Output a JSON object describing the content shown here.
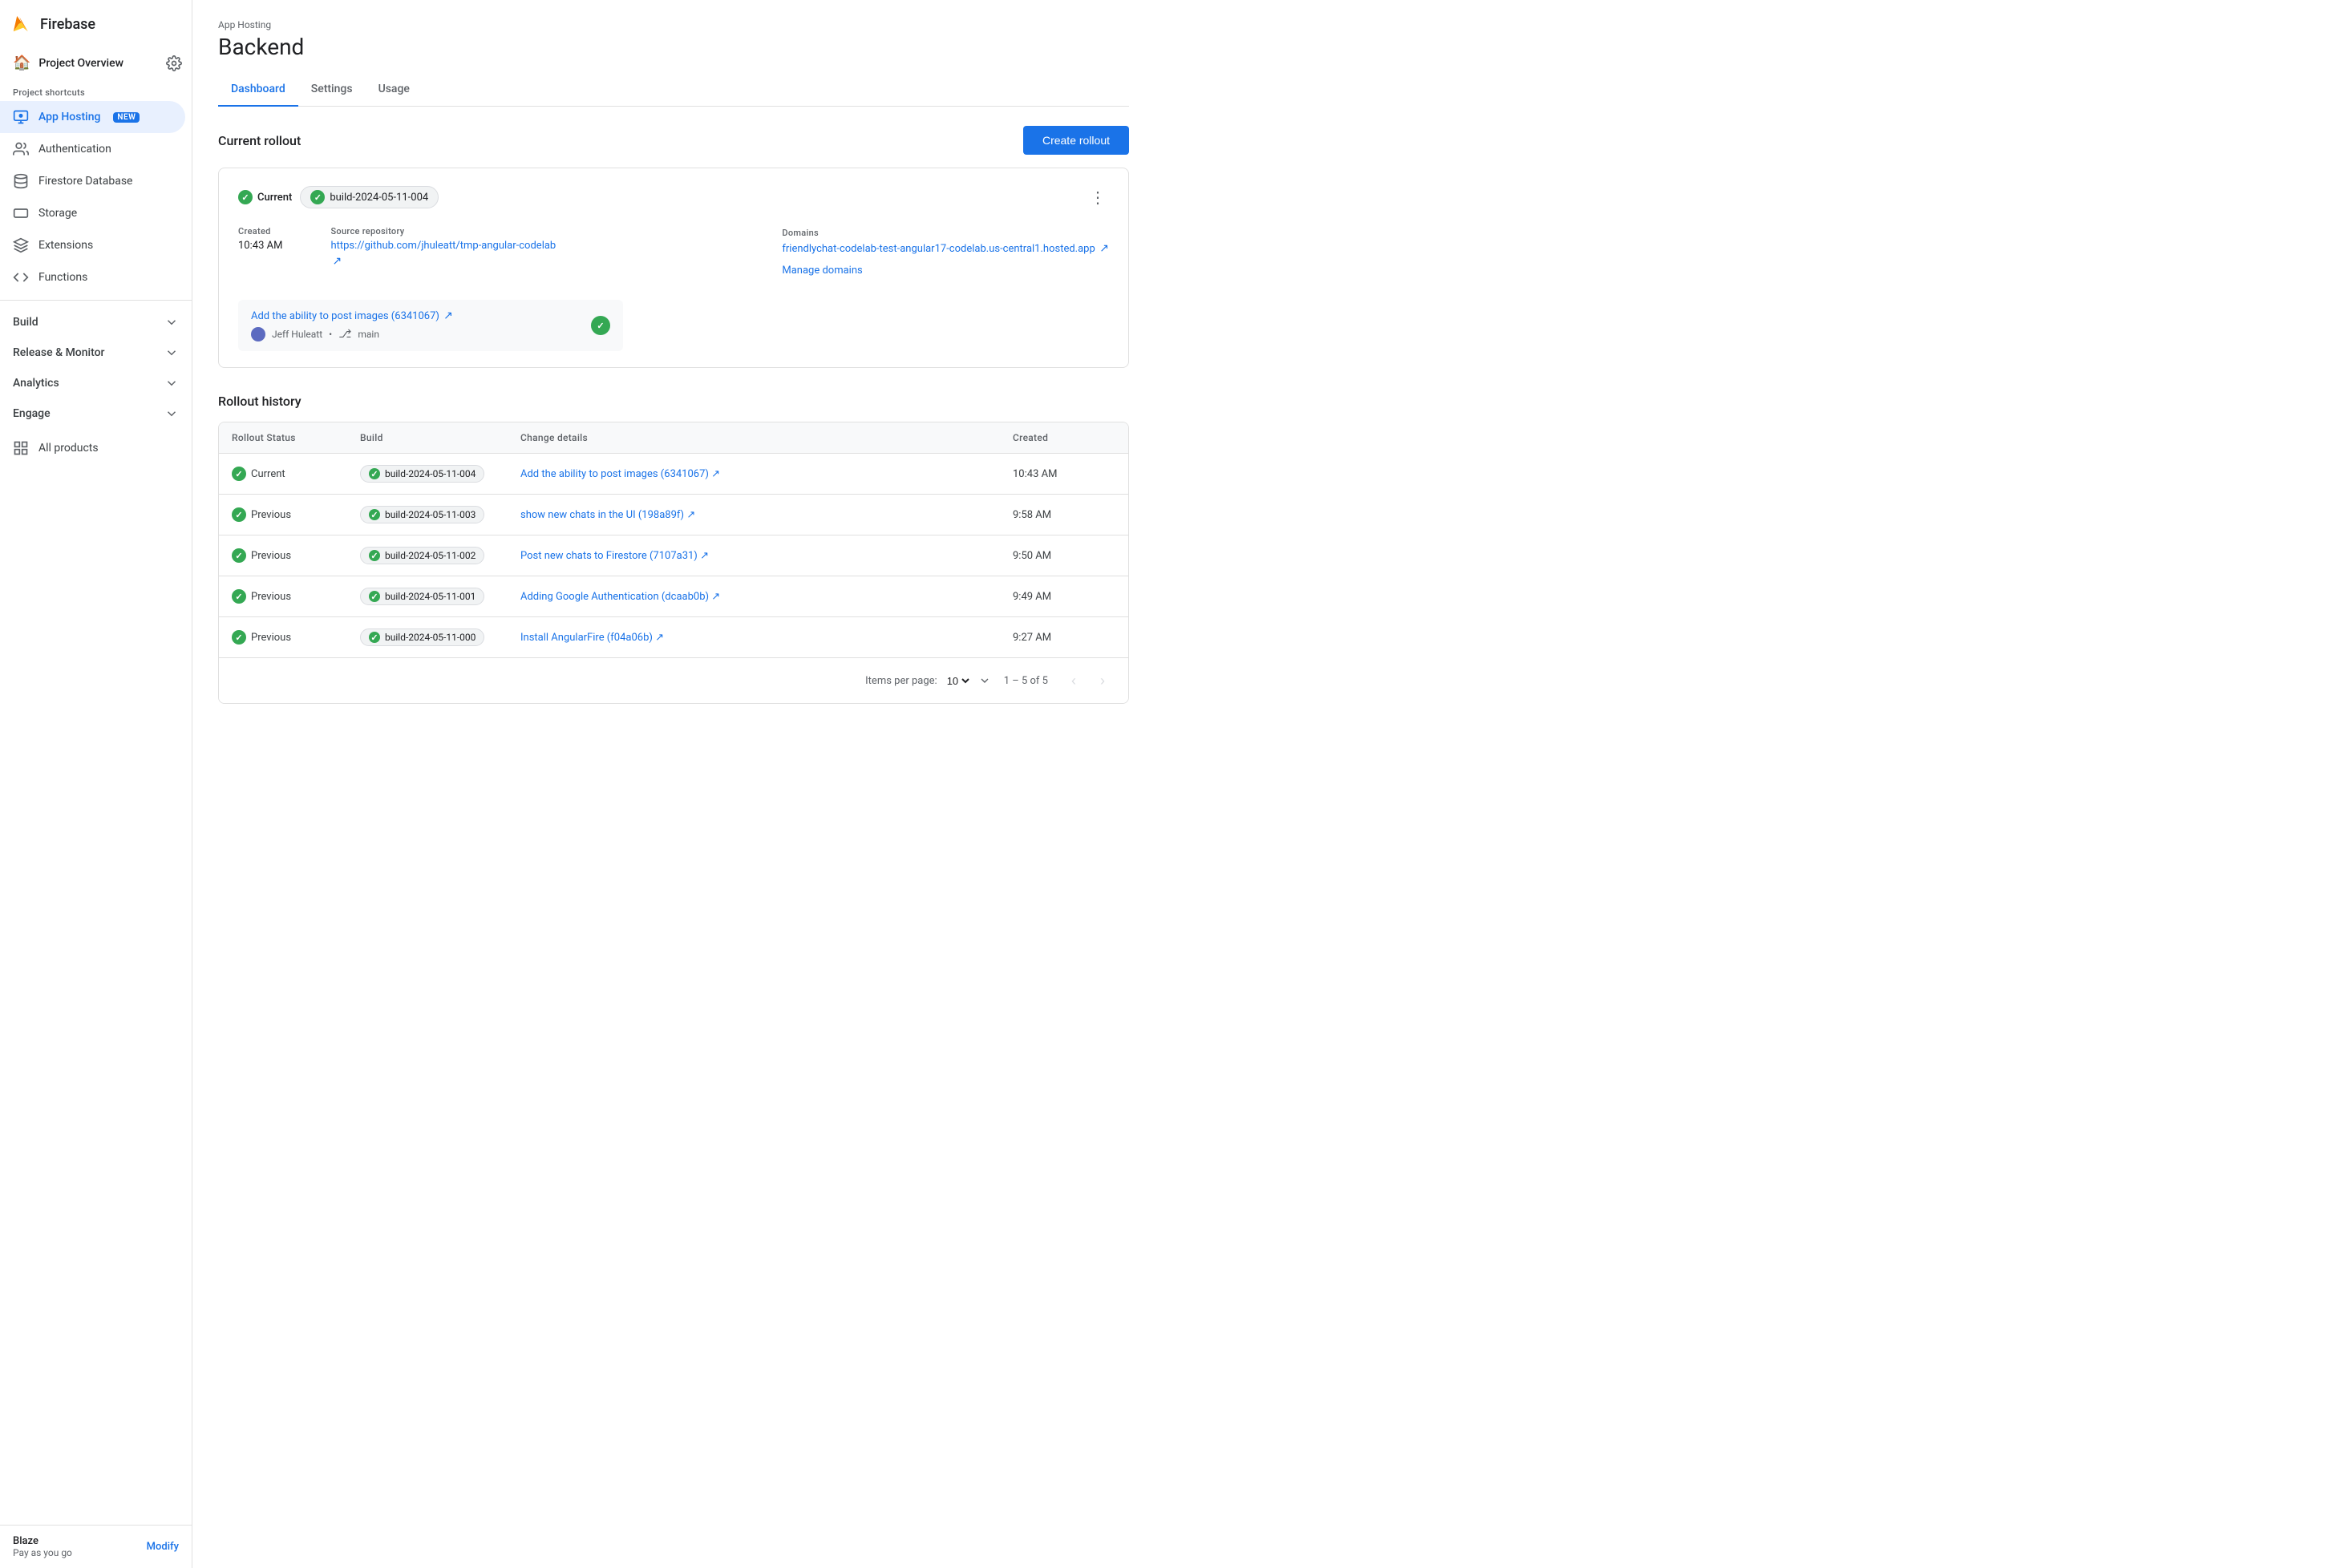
{
  "sidebar": {
    "app_name": "Firebase",
    "project_label": "Project Overview",
    "shortcuts_label": "Project shortcuts",
    "nav_items": [
      {
        "id": "app-hosting",
        "label": "App Hosting",
        "badge": "NEW",
        "active": true
      },
      {
        "id": "authentication",
        "label": "Authentication",
        "active": false
      },
      {
        "id": "firestore",
        "label": "Firestore Database",
        "active": false
      },
      {
        "id": "storage",
        "label": "Storage",
        "active": false
      },
      {
        "id": "extensions",
        "label": "Extensions",
        "active": false
      },
      {
        "id": "functions",
        "label": "Functions",
        "active": false
      }
    ],
    "categories": [
      {
        "id": "build",
        "label": "Build"
      },
      {
        "id": "release-monitor",
        "label": "Release & Monitor"
      },
      {
        "id": "analytics",
        "label": "Analytics"
      },
      {
        "id": "engage",
        "label": "Engage"
      }
    ],
    "all_products": "All products",
    "footer": {
      "plan_name": "Blaze",
      "plan_type": "Pay as you go",
      "modify_label": "Modify"
    }
  },
  "header": {
    "subtitle": "App Hosting",
    "title": "Backend",
    "tabs": [
      {
        "id": "dashboard",
        "label": "Dashboard",
        "active": true
      },
      {
        "id": "settings",
        "label": "Settings",
        "active": false
      },
      {
        "id": "usage",
        "label": "Usage",
        "active": false
      }
    ]
  },
  "current_rollout": {
    "section_title": "Current rollout",
    "create_button": "Create rollout",
    "status": "Current",
    "build_id": "build-2024-05-11-004",
    "created_label": "Created",
    "created_time": "10:43 AM",
    "source_label": "Source repository",
    "source_url": "https://github.com/jhuleatt/tmp-angular-codelab",
    "domains_label": "Domains",
    "domains_url": "friendlychat-codelab-test-angular17-codelab.us-central1.hosted.app",
    "commit_title": "Add the ability to post images (6341067)",
    "commit_hash": "6341067",
    "commit_author": "Jeff Huleatt",
    "commit_branch": "main",
    "manage_domains": "Manage domains"
  },
  "rollout_history": {
    "title": "Rollout history",
    "columns": [
      "Rollout Status",
      "Build",
      "Change details",
      "Created"
    ],
    "rows": [
      {
        "status": "Current",
        "build": "build-2024-05-11-004",
        "change": "Add the ability to post images (6341067)",
        "created": "10:43 AM"
      },
      {
        "status": "Previous",
        "build": "build-2024-05-11-003",
        "change": "show new chats in the UI (198a89f)",
        "created": "9:58 AM"
      },
      {
        "status": "Previous",
        "build": "build-2024-05-11-002",
        "change": "Post new chats to Firestore (7107a31)",
        "created": "9:50 AM"
      },
      {
        "status": "Previous",
        "build": "build-2024-05-11-001",
        "change": "Adding Google Authentication (dcaab0b)",
        "created": "9:49 AM"
      },
      {
        "status": "Previous",
        "build": "build-2024-05-11-000",
        "change": "Install AngularFire (f04a06b)",
        "created": "9:27 AM"
      }
    ],
    "pagination": {
      "items_per_page_label": "Items per page:",
      "items_per_page": "10",
      "page_info": "1 – 5 of 5"
    }
  }
}
